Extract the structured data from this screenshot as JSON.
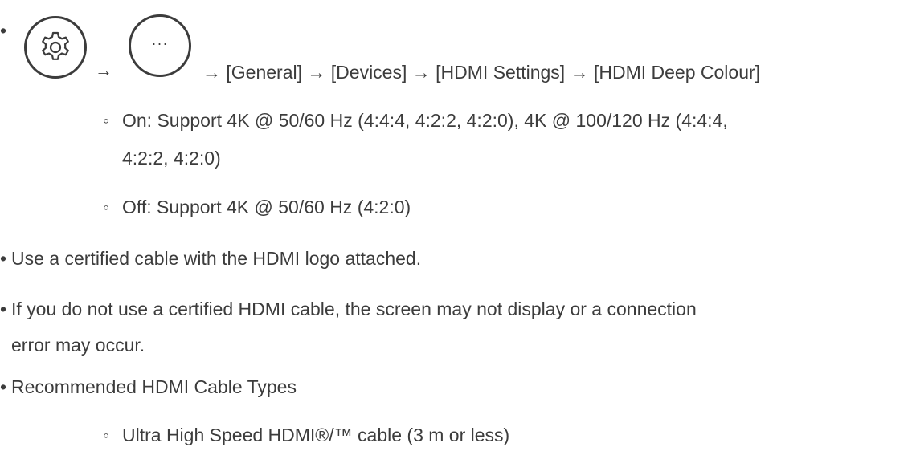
{
  "bullet_symbol": "•",
  "sub_bullet_symbol": "◦",
  "path": {
    "icons": [
      "gear-icon",
      "more-options-icon"
    ],
    "arrow": "→",
    "more_dots": "···",
    "trail": "→ [General] → [Devices] → [HDMI Settings] → [HDMI Deep Colour]"
  },
  "deep_colour_options": [
    {
      "line1": "On: Support 4K @ 50/60 Hz (4:4:4, 4:2:2, 4:2:0), 4K @ 100/120 Hz (4:4:4,",
      "line2": "4:2:2, 4:2:0)"
    },
    {
      "line1": "Off: Support 4K @ 50/60 Hz (4:2:0)"
    }
  ],
  "notes": [
    {
      "line1": "Use a certified cable with the HDMI logo attached."
    },
    {
      "line1": "If you do not use a certified HDMI cable, the screen may not display or a connection",
      "line2": "error may occur."
    },
    {
      "line1": "Recommended HDMI Cable Types"
    }
  ],
  "cable_types": [
    "Ultra High Speed HDMI®/™ cable (3 m or less)"
  ]
}
